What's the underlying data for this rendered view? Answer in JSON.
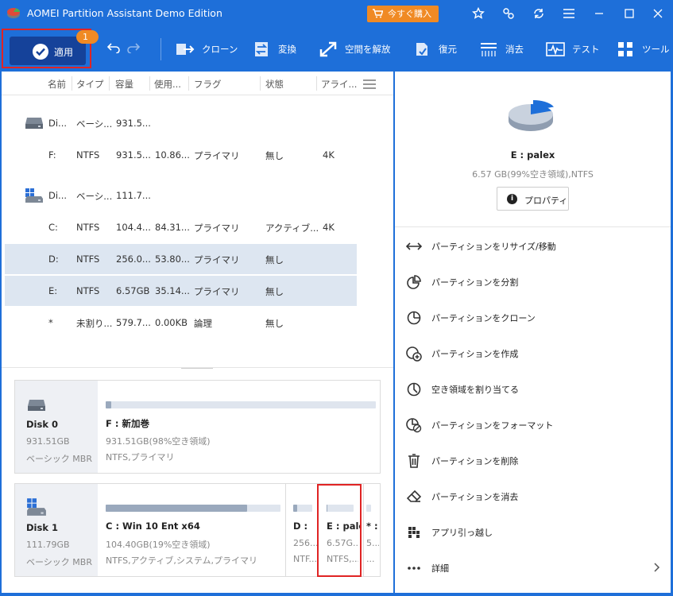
{
  "window": {
    "title": "AOMEI Partition Assistant Demo Edition",
    "buy_label": "今すぐ購入"
  },
  "toolbar": {
    "apply_label": "適用",
    "pending_count": "1",
    "tools": [
      {
        "label": "クローン",
        "icon": "clone-icon"
      },
      {
        "label": "変換",
        "icon": "convert-icon"
      },
      {
        "label": "空間を解放",
        "icon": "free-space-icon"
      },
      {
        "label": "復元",
        "icon": "recover-icon"
      },
      {
        "label": "消去",
        "icon": "wipe-icon"
      },
      {
        "label": "テスト",
        "icon": "test-icon"
      },
      {
        "label": "ツール",
        "icon": "tools-icon"
      }
    ]
  },
  "columns": [
    "名前",
    "タイプ",
    "容量",
    "使用...",
    "フラグ",
    "状態",
    "アライ..."
  ],
  "rows": [
    {
      "kind": "disk",
      "name": "Di...",
      "type": "ベーシ...",
      "cap": "931.5...",
      "used": "",
      "flag": "",
      "status": "",
      "align": "",
      "selected": false
    },
    {
      "kind": "part",
      "name": "F:",
      "type": "NTFS",
      "cap": "931.5...",
      "used": "10.86...",
      "flag": "プライマリ",
      "status": "無し",
      "align": "4K",
      "selected": false
    },
    {
      "kind": "disk",
      "name": "Di...",
      "type": "ベーシ...",
      "cap": "111.7...",
      "used": "",
      "flag": "",
      "status": "",
      "align": "",
      "selected": false
    },
    {
      "kind": "part",
      "name": "C:",
      "type": "NTFS",
      "cap": "104.4...",
      "used": "84.31...",
      "flag": "プライマリ",
      "status": "アクティブ...",
      "align": "4K",
      "selected": false
    },
    {
      "kind": "part",
      "name": "D:",
      "type": "NTFS",
      "cap": "256.0...",
      "used": "53.80...",
      "flag": "プライマリ",
      "status": "無し",
      "align": "",
      "selected": true
    },
    {
      "kind": "part",
      "name": "E:",
      "type": "NTFS",
      "cap": "6.57GB",
      "used": "35.14...",
      "flag": "プライマリ",
      "status": "無し",
      "align": "",
      "selected": true
    },
    {
      "kind": "part",
      "name": "*",
      "type": "未割り...",
      "cap": "579.7...",
      "used": "0.00KB",
      "flag": "論理",
      "status": "無し",
      "align": "",
      "selected": false
    }
  ],
  "diskmap": [
    {
      "name": "Disk 0",
      "size": "931.51GB",
      "style": "ベーシック MBR",
      "partitions": [
        {
          "name": "F : 新加巻",
          "size": "931.51GB(98%空き領域)",
          "fs": "NTFS,プライマリ",
          "used_fraction": 0.02
        }
      ]
    },
    {
      "name": "Disk 1",
      "size": "111.79GB",
      "style": "ベーシック MBR",
      "partitions": [
        {
          "name": "C : Win 10 Ent x64",
          "size": "104.40GB(19%空き領域)",
          "fs": "NTFS,アクティブ,システム,プライマリ",
          "used_fraction": 0.81
        },
        {
          "name": "D :",
          "size": "256....",
          "fs": "NTF...",
          "used_fraction": 0.2
        },
        {
          "name": "E : palex",
          "size": "6.57G...",
          "fs": "NTFS,...",
          "used_fraction": 0.01
        },
        {
          "name": "* :",
          "size": "5...",
          "fs": "...",
          "used_fraction": 0.0
        }
      ]
    }
  ],
  "selected": {
    "name": "E : palex",
    "detail": "6.57 GB(99%空き領域),NTFS",
    "properties_label": "プロパティ"
  },
  "operations": [
    {
      "label": "パーティションをリサイズ/移動",
      "icon": "resize-move-icon"
    },
    {
      "label": "パーティションを分割",
      "icon": "split-icon"
    },
    {
      "label": "パーティションをクローン",
      "icon": "clone-partition-icon"
    },
    {
      "label": "パーティションを作成",
      "icon": "create-partition-icon"
    },
    {
      "label": "空き領域を割り当てる",
      "icon": "allocate-space-icon"
    },
    {
      "label": "パーティションをフォーマット",
      "icon": "format-icon"
    },
    {
      "label": "パーティションを削除",
      "icon": "trash-icon"
    },
    {
      "label": "パーティションを消去",
      "icon": "eraser-icon"
    },
    {
      "label": "アプリ引っ越し",
      "icon": "app-mover-icon"
    },
    {
      "label": "詳細",
      "icon": "more-dots-icon"
    }
  ],
  "colors": {
    "accent": "#1e6fd9",
    "apply_button": "#15429a",
    "badge": "#f08a24",
    "highlight": "#e02424",
    "selected_row": "#dde6f1"
  }
}
